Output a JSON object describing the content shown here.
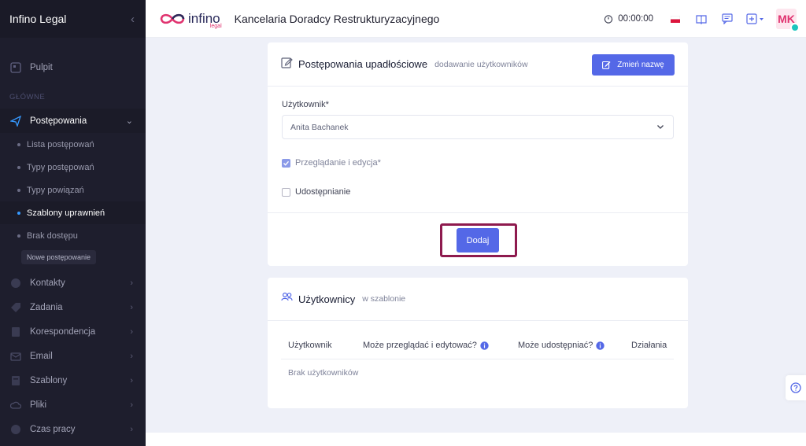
{
  "sidebar": {
    "brand": "Infino Legal",
    "dashboard": "Pulpit",
    "section_main": "GŁÓWNE",
    "proceedings": "Postępowania",
    "sub": [
      "Lista postępowań",
      "Typy postępowań",
      "Typy powiązań",
      "Szablony uprawnień",
      "Brak dostępu"
    ],
    "new_badge": "Nowe postępowanie",
    "items": [
      "Kontakty",
      "Zadania",
      "Korespondencja",
      "Email",
      "Szablony",
      "Pliki",
      "Czas pracy"
    ]
  },
  "header": {
    "logo_text": "infino",
    "logo_sub": "legal",
    "title": "Kancelaria Doradcy Restrukturyzacyjnego",
    "timer": "00:00:00",
    "avatar": "MK"
  },
  "card1": {
    "title": "Postępowania upadłościowe",
    "subtitle": "dodawanie użytkowników",
    "rename_button": "Zmień nazwę",
    "user_label": "Użytkownik*",
    "user_value": "Anita Bachanek",
    "check_view": "Przeglądanie i edycja*",
    "check_share": "Udostępnianie",
    "add_button": "Dodaj"
  },
  "card2": {
    "title": "Użytkownicy",
    "subtitle": "w szablonie",
    "columns": [
      "Użytkownik",
      "Może przeglądać i edytować?",
      "Może udostępniać?",
      "Działania"
    ],
    "empty": "Brak użytkowników"
  },
  "colors": {
    "sidebar_bg": "#1e1e2d",
    "primary": "#5468e7",
    "highlight": "#8e1a4e",
    "brand_pink": "#e0336f"
  }
}
